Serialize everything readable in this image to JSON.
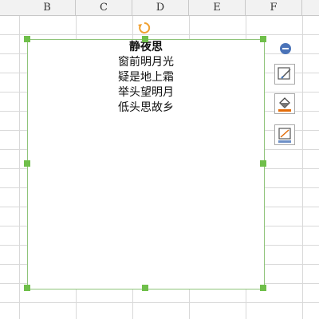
{
  "columns": [
    "B",
    "C",
    "D",
    "E",
    "F"
  ],
  "textbox": {
    "lines": [
      "静夜思",
      "窗前明月光",
      "疑是地上霜",
      "举头望明月",
      "低头思故乡"
    ]
  },
  "side_toolbar": {
    "buttons": [
      "collapse-icon",
      "edit-shape-icon",
      "fill-color-icon",
      "outline-color-icon"
    ]
  },
  "colors": {
    "selection_border": "#8fc47a",
    "handle": "#6fbf4a",
    "rotate_handle": "#f0a030",
    "fill_accent": "#e36c09",
    "outline_accent": "#e36c09"
  }
}
